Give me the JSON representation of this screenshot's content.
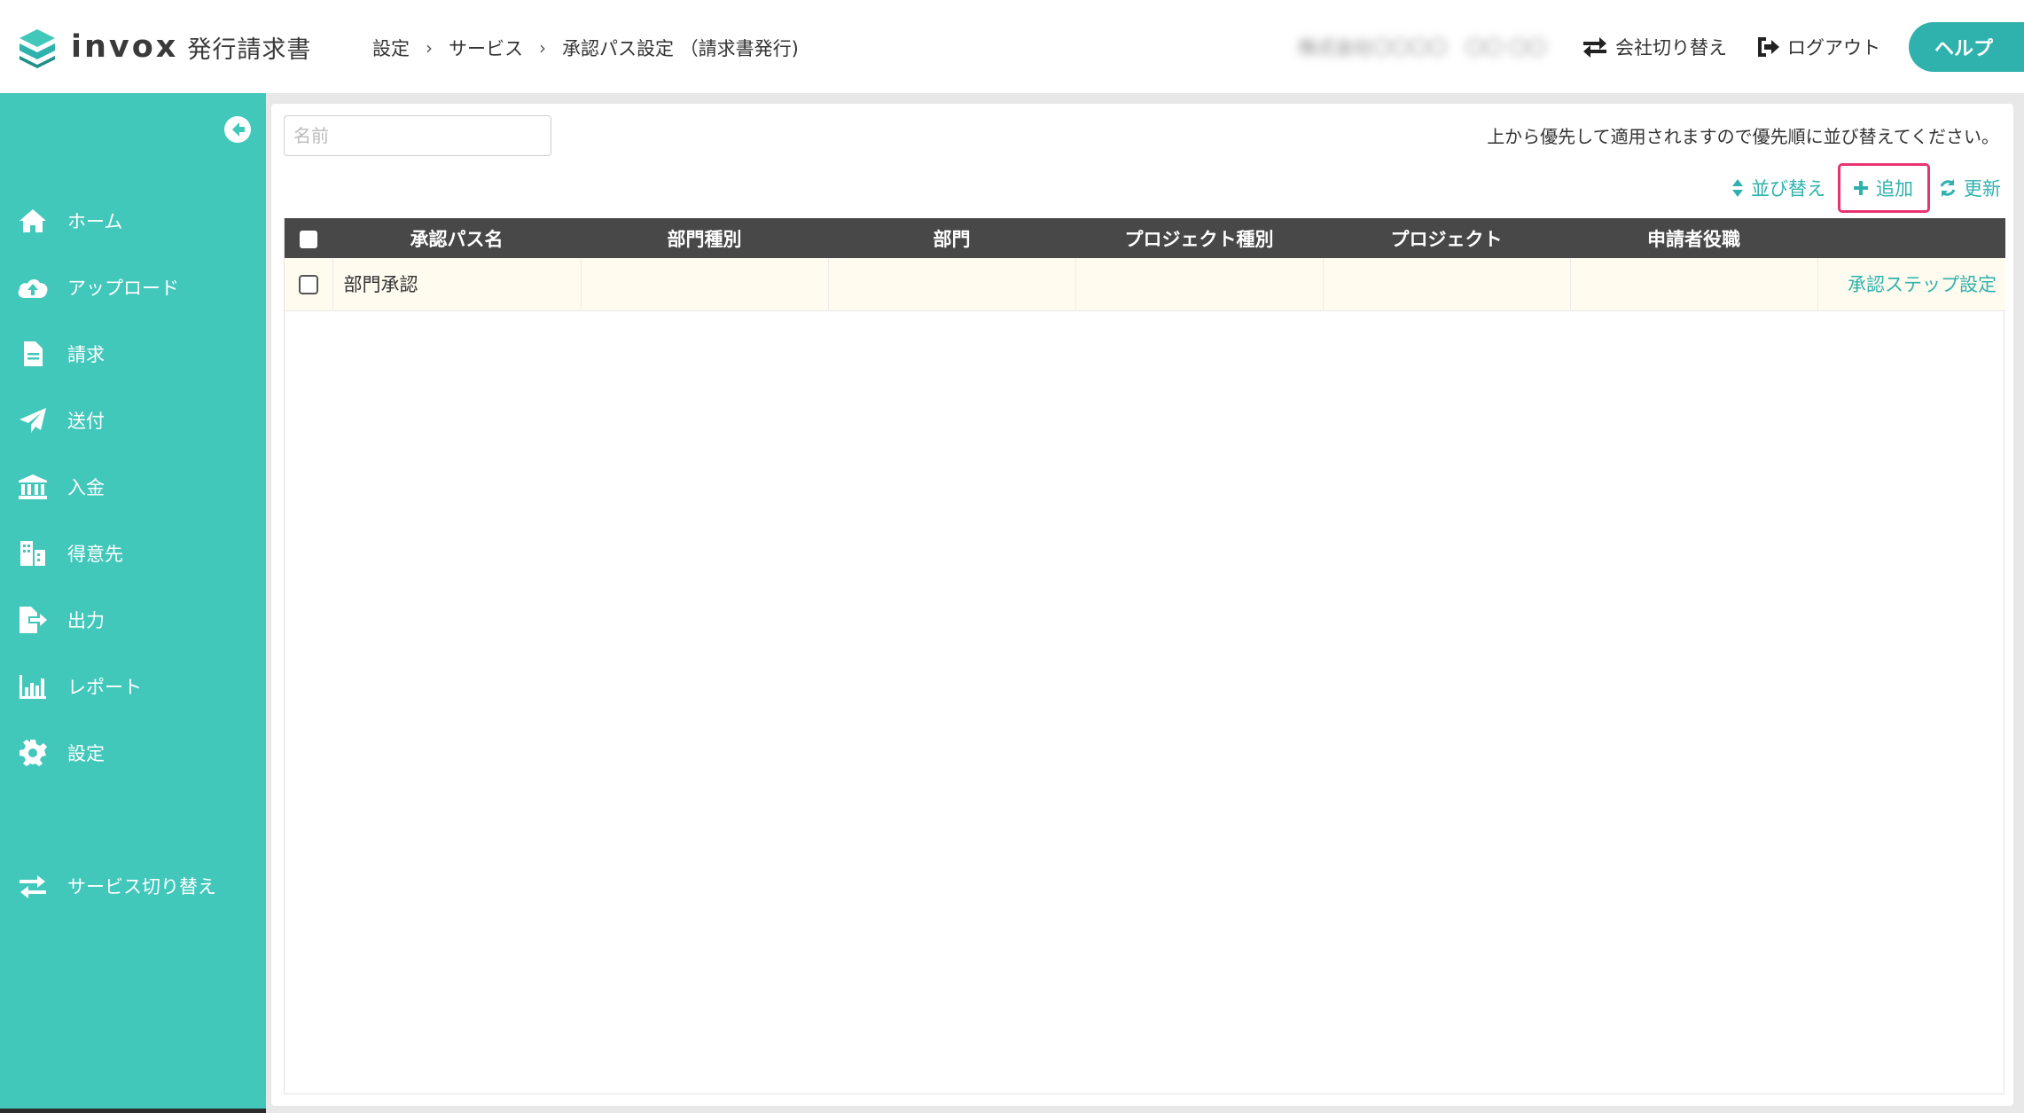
{
  "header": {
    "logo_word": "invox",
    "logo_sub": "発行請求書",
    "breadcrumb": [
      "設定",
      "サービス",
      "承認パス設定 （請求書発行)"
    ],
    "user_name": "株式会社〇〇〇〇　〇〇 〇〇",
    "switch_company_label": "会社切り替え",
    "logout_label": "ログアウト",
    "help_label": "ヘルプ"
  },
  "sidebar": {
    "items": [
      {
        "label": "ホーム",
        "icon": "home-icon"
      },
      {
        "label": "アップロード",
        "icon": "cloud-upload-icon"
      },
      {
        "label": "請求",
        "icon": "document-icon"
      },
      {
        "label": "送付",
        "icon": "paper-plane-icon"
      },
      {
        "label": "入金",
        "icon": "bank-icon"
      },
      {
        "label": "得意先",
        "icon": "building-icon"
      },
      {
        "label": "出力",
        "icon": "file-export-icon"
      },
      {
        "label": "レポート",
        "icon": "chart-icon"
      },
      {
        "label": "設定",
        "icon": "gear-icon"
      }
    ],
    "switch_service_label": "サービス切り替え"
  },
  "main": {
    "name_filter_placeholder": "名前",
    "notice": "上から優先して適用されますので優先順に並び替えてください。",
    "toolbar": {
      "sort_label": "並び替え",
      "add_label": "追加",
      "refresh_label": "更新"
    },
    "table": {
      "columns": [
        "承認パス名",
        "部門種別",
        "部門",
        "プロジェクト種別",
        "プロジェクト",
        "申請者役職",
        ""
      ],
      "rows": [
        {
          "name": "部門承認",
          "dept_type": "",
          "dept": "",
          "project_type": "",
          "project": "",
          "role": "",
          "action": "承認ステップ設定"
        }
      ]
    }
  },
  "colors": {
    "accent": "#42c7bb",
    "help_button": "#2fb2ad",
    "table_header": "#484848",
    "highlight_border": "#e8336f",
    "row_background": "#fffbef"
  }
}
